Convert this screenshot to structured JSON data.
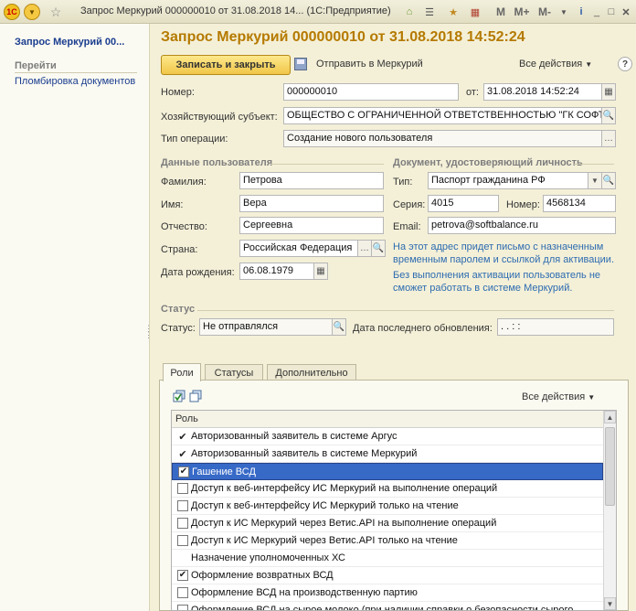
{
  "window": {
    "title": "Запрос Меркурий 000000010 от 31.08.2018 14... (1С:Предприятие)",
    "logo": "1C",
    "icons": [
      "menu-icon",
      "star-icon",
      "home-icon",
      "favorites-icon",
      "calendar-icon"
    ],
    "m_buttons": [
      "M",
      "M+",
      "M-"
    ]
  },
  "sidebar": {
    "title": "Запрос Меркурий 00...",
    "section": "Перейти",
    "link": "Пломбировка документов"
  },
  "form": {
    "title": "Запрос Меркурий 000000010 от 31.08.2018 14:52:24",
    "save_close": "Записать и закрыть",
    "send": "Отправить в Меркурий",
    "all_actions": "Все действия",
    "help": "?"
  },
  "fields": {
    "number_label": "Номер:",
    "number": "000000010",
    "date_label": "от:",
    "date": "31.08.2018 14:52:24",
    "entity_label": "Хозяйствующий субъект:",
    "entity": "ОБЩЕСТВО С ОГРАНИЧЕННОЙ ОТВЕТСТВЕННОСТЬЮ \"ГК СОФТ",
    "optype_label": "Тип операции:",
    "optype": "Создание нового пользователя"
  },
  "user": {
    "section": "Данные пользователя",
    "lastname_label": "Фамилия:",
    "lastname": "Петрова",
    "firstname_label": "Имя:",
    "firstname": "Вера",
    "patronymic_label": "Отчество:",
    "patronymic": "Сергеевна",
    "country_label": "Страна:",
    "country": "Российская Федерация",
    "birth_label": "Дата рождения:",
    "birth": "06.08.1979"
  },
  "doc": {
    "section": "Документ, удостоверяющий личность",
    "type_label": "Тип:",
    "type": "Паспорт гражданина РФ",
    "series_label": "Серия:",
    "series": "4015",
    "number_label": "Номер:",
    "number": "4568134",
    "email_label": "Email:",
    "email": "petrova@softbalance.ru",
    "hint1": "На этот адрес придет письмо с назначенным временным паролем и ссылкой для активации.",
    "hint2": "Без выполнения активации пользователь не сможет работать в системе Меркурий."
  },
  "status": {
    "section": "Статус",
    "status_label": "Статус:",
    "status": "Не отправлялся",
    "updated_label": "Дата последнего обновления:",
    "updated": " .  .     :  :"
  },
  "tabs": [
    "Роли",
    "Статусы",
    "Дополнительно"
  ],
  "roles": {
    "all_actions": "Все действия",
    "header": "Роль",
    "rows": [
      {
        "label": "Авторизованный заявитель в системе Аргус",
        "mark": "tick"
      },
      {
        "label": "Авторизованный заявитель в системе Меркурий",
        "mark": "tick"
      },
      {
        "label": "Гашение ВСД",
        "mark": "checked",
        "selected": true
      },
      {
        "label": "Доступ к веб-интерфейсу ИС Меркурий на выполнение операций",
        "mark": "box"
      },
      {
        "label": "Доступ к веб-интерфейсу ИС Меркурий только на чтение",
        "mark": "box"
      },
      {
        "label": "Доступ к ИС Меркурий через Ветис.API на выполнение операций",
        "mark": "box"
      },
      {
        "label": "Доступ к ИС Меркурий через Ветис.API только на чтение",
        "mark": "box"
      },
      {
        "label": "Назначение уполномоченных ХС",
        "mark": "none"
      },
      {
        "label": "Оформление возвратных ВСД",
        "mark": "checked"
      },
      {
        "label": "Оформление ВСД на производственную партию",
        "mark": "box"
      },
      {
        "label": "Оформление ВСД на сырое молоко (при наличии справки о безопасности сырого",
        "mark": "box"
      }
    ]
  },
  "check_glyph": "✔"
}
